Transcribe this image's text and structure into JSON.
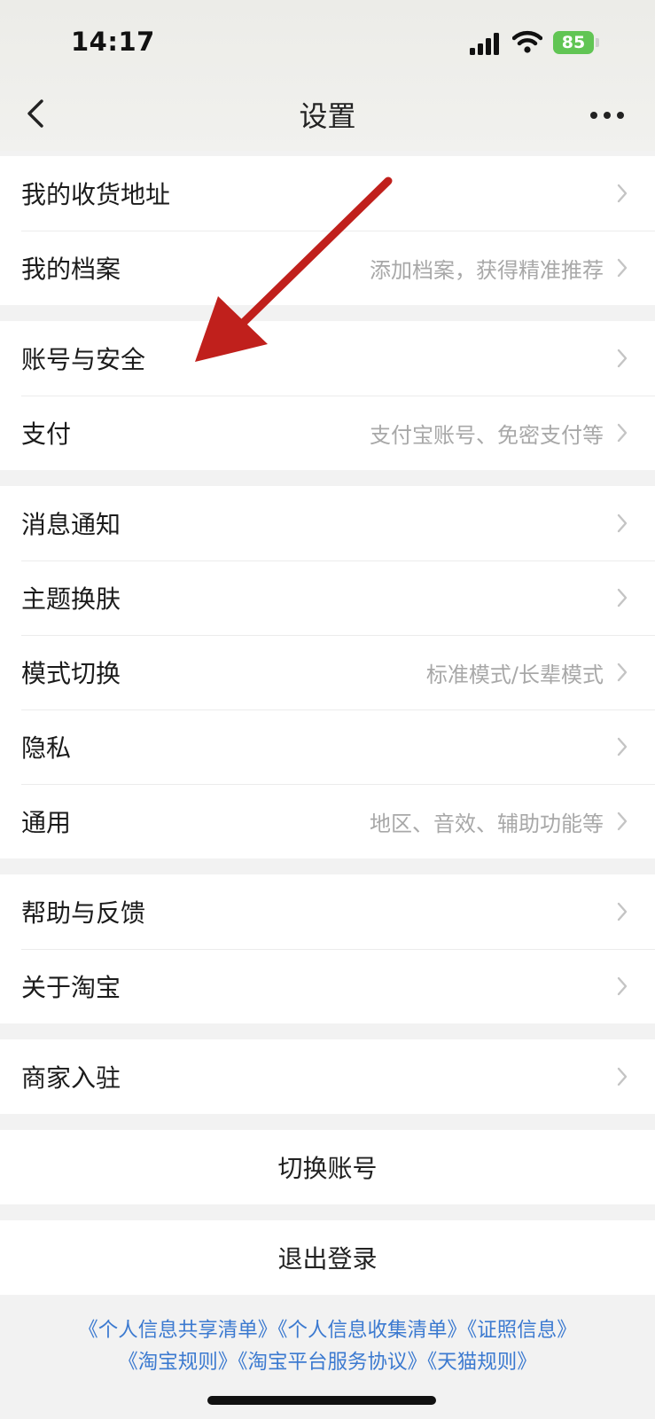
{
  "status_bar": {
    "time": "14:17",
    "battery": "85"
  },
  "nav": {
    "back_icon": "chevron-left-icon",
    "title": "设置",
    "more_icon": "more-horizontal-icon"
  },
  "groups": [
    [
      {
        "label": "我的收货地址",
        "desc": ""
      },
      {
        "label": "我的档案",
        "desc": "添加档案，获得精准推荐"
      }
    ],
    [
      {
        "label": "账号与安全",
        "desc": ""
      },
      {
        "label": "支付",
        "desc": "支付宝账号、免密支付等"
      }
    ],
    [
      {
        "label": "消息通知",
        "desc": ""
      },
      {
        "label": "主题换肤",
        "desc": ""
      },
      {
        "label": "模式切换",
        "desc": "标准模式/长辈模式"
      },
      {
        "label": "隐私",
        "desc": ""
      },
      {
        "label": "通用",
        "desc": "地区、音效、辅助功能等"
      }
    ],
    [
      {
        "label": "帮助与反馈",
        "desc": ""
      },
      {
        "label": "关于淘宝",
        "desc": ""
      }
    ],
    [
      {
        "label": "商家入驻",
        "desc": ""
      }
    ]
  ],
  "actions": {
    "switch_account": "切换账号",
    "logout": "退出登录"
  },
  "footer": {
    "line1": [
      "《个人信息共享清单》",
      "《个人信息收集清单》",
      "《证照信息》"
    ],
    "line2": [
      "《淘宝规则》",
      "《淘宝平台服务协议》",
      "《天猫规则》"
    ]
  },
  "annotation": {
    "arrow_color": "#c0201c"
  },
  "colors": {
    "link": "#3c7ad0",
    "battery": "#61c554",
    "desc_text": "#a8a8a8"
  }
}
